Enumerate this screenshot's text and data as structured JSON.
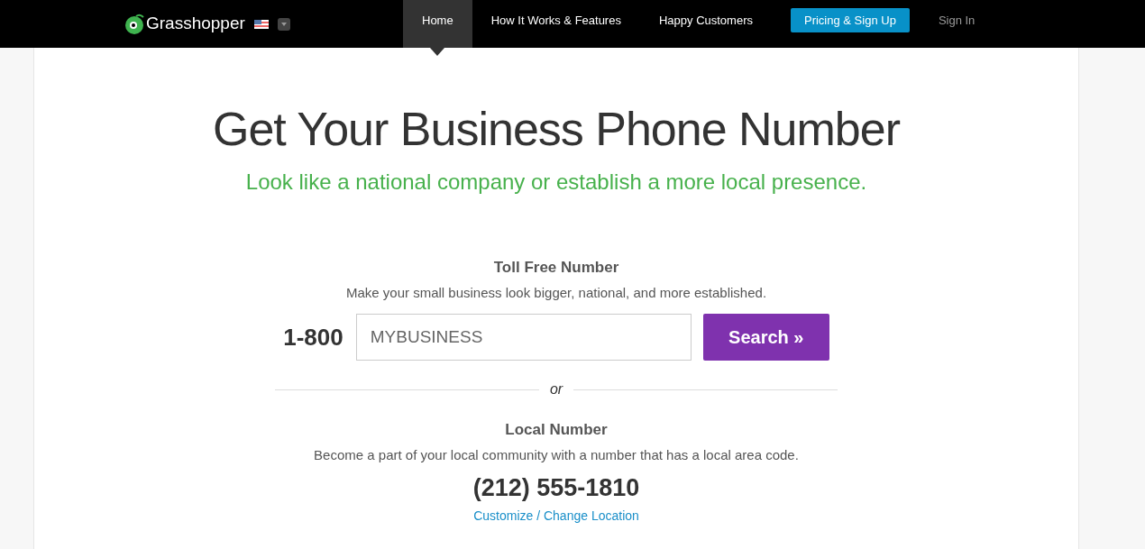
{
  "nav": {
    "logo": "Grasshopper",
    "items": [
      {
        "label": "Home",
        "selected": true
      },
      {
        "label": "How It Works & Features",
        "selected": false
      },
      {
        "label": "Happy Customers",
        "selected": false
      }
    ],
    "cta": "Pricing & Sign Up",
    "sign_in": "Sign In"
  },
  "hero": {
    "title": "Get Your Business Phone Number",
    "subtitle": "Look like a national company or establish a more local presence."
  },
  "toll_free": {
    "title": "Toll Free Number",
    "description": "Make your small business look bigger, national, and more established.",
    "prefix": "1-800",
    "placeholder": "MYBUSINESS",
    "button": "Search »"
  },
  "divider": "or",
  "local": {
    "title": "Local Number",
    "description": "Become a part of your local community with a number that has a local area code.",
    "number": "(212) 555-1810",
    "link": "Customize / Change Location"
  }
}
